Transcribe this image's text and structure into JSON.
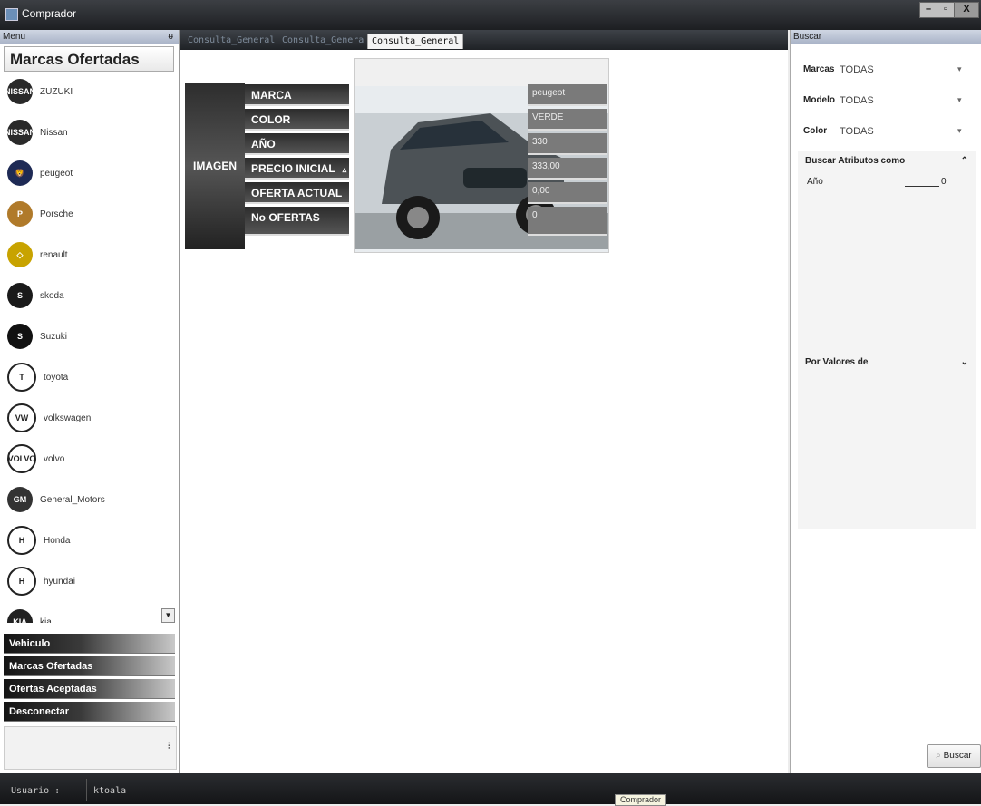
{
  "window": {
    "title": "Comprador",
    "minimize": "–",
    "maximize": "▫",
    "close": "X"
  },
  "menu": {
    "header": "Menu",
    "pin": "ᵾ",
    "section_title": "Marcas Ofertadas",
    "brands": [
      {
        "name": "ZUZUKI",
        "icon": "nissan-logo-icon",
        "abbr": "NISSAN",
        "color": "#2a2a2a"
      },
      {
        "name": "Nissan",
        "icon": "nissan-logo-icon",
        "abbr": "NISSAN",
        "color": "#2a2a2a"
      },
      {
        "name": "peugeot",
        "icon": "peugeot-lion-icon",
        "abbr": "🦁",
        "color": "#1e2a55"
      },
      {
        "name": "Porsche",
        "icon": "porsche-crest-icon",
        "abbr": "P",
        "color": "#b07a2a"
      },
      {
        "name": "renault",
        "icon": "renault-diamond-icon",
        "abbr": "◇",
        "color": "#c8a300"
      },
      {
        "name": "skoda",
        "icon": "skoda-arrow-icon",
        "abbr": "S",
        "color": "#1a1a1a"
      },
      {
        "name": "Suzuki",
        "icon": "suzuki-s-icon",
        "abbr": "S",
        "color": "#111"
      },
      {
        "name": "toyota",
        "icon": "toyota-ellipses-icon",
        "abbr": "T",
        "color": "#fff"
      },
      {
        "name": "volkswagen",
        "icon": "volkswagen-vw-icon",
        "abbr": "VW",
        "color": "#fff"
      },
      {
        "name": "volvo",
        "icon": "volvo-wordmark-icon",
        "abbr": "VOLVO",
        "color": "#fff"
      },
      {
        "name": "General_Motors",
        "icon": "gm-square-icon",
        "abbr": "GM",
        "color": "#333"
      },
      {
        "name": "Honda",
        "icon": "honda-h-icon",
        "abbr": "H",
        "color": "#fff"
      },
      {
        "name": "hyundai",
        "icon": "hyundai-h-icon",
        "abbr": "H",
        "color": "#fff"
      },
      {
        "name": "kia",
        "icon": "kia-oval-icon",
        "abbr": "KIA",
        "color": "#222"
      }
    ],
    "nav": [
      "Vehiculo",
      "Marcas Ofertadas",
      "Ofertas Aceptadas",
      "Desconectar"
    ]
  },
  "tabs": [
    {
      "label": "Consulta_General",
      "active": false
    },
    {
      "label": "Consulta_Genera",
      "active": false
    },
    {
      "label": "Consulta_General",
      "active": true
    }
  ],
  "card": {
    "image_label": "IMAGEN",
    "labels": [
      "MARCA",
      "COLOR",
      "AÑO",
      "PRECIO INICIAL",
      "OFERTA ACTUAL",
      "No OFERTAS"
    ],
    "sort_marker": "▵",
    "values": [
      "peugeot",
      "VERDE",
      "330",
      "333,00",
      "0,00",
      "0"
    ]
  },
  "search": {
    "header": "Buscar",
    "filters": [
      {
        "label": "Marcas",
        "value": "TODAS"
      },
      {
        "label": "Modelo",
        "value": "TODAS"
      },
      {
        "label": "Color",
        "value": "TODAS"
      }
    ],
    "section1": "Buscar Atributos como",
    "attr_label": "Año",
    "attr_value": "0",
    "section2": "Por Valores de",
    "button": "Buscar"
  },
  "status": {
    "user_label": "Usuario :",
    "user_value": "ktoala",
    "tooltip": "Comprador"
  }
}
